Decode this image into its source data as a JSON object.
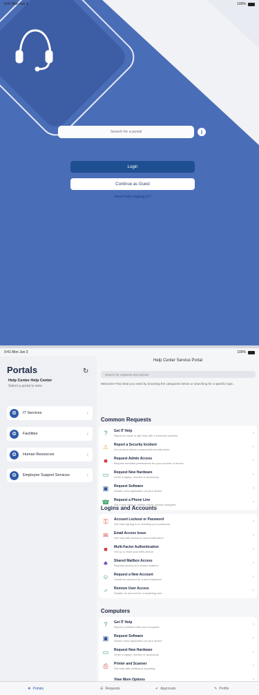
{
  "login_screen": {
    "status": {
      "time": "9:41 Mon Jun 3",
      "battery": "100%"
    },
    "search_placeholder": "Search for a portal",
    "info_symbol": "i",
    "login_label": "Login",
    "guest_label": "Continue as Guest",
    "help_link": "Need help logging in?",
    "colors": {
      "brand_blue": "#4a6db8",
      "button_blue": "#1e4f91"
    }
  },
  "portal_screen": {
    "status": {
      "time": "9:41 Mon Jun 3",
      "battery": "100%"
    },
    "sidebar": {
      "title": "Portals",
      "subtitle": "Help Center Help Center",
      "caption": "Select a portal to view",
      "items": [
        {
          "label": "IT Services"
        },
        {
          "label": "Facilities"
        },
        {
          "label": "Human Resources"
        },
        {
          "label": "Employee Support Services"
        }
      ]
    },
    "main": {
      "title": "Help Center Service Portal",
      "search_placeholder": "Search for requests and articles",
      "description": "Welcome! Find what you need by browsing the categories below or searching for a specific topic.",
      "sections": [
        {
          "heading": "Common Requests",
          "rows": [
            {
              "title": "Get IT Help",
              "subtitle": "Report an issue or get help with a technical problem",
              "icon": "help-icon"
            },
            {
              "title": "Report a Security Incident",
              "subtitle": "Let us know about a suspected security issue",
              "icon": "warning-icon"
            },
            {
              "title": "Request Admin Access",
              "subtitle": "Request elevated permissions for your account or device",
              "icon": "lock-icon"
            },
            {
              "title": "Request New Hardware",
              "subtitle": "Order a laptop, monitor or accessory",
              "icon": "laptop-icon"
            },
            {
              "title": "Request Software",
              "subtitle": "Install a new application on your device",
              "icon": "software-icon"
            },
            {
              "title": "Request a Phone Line",
              "subtitle": "Get a new desk or mobile phone number assigned",
              "icon": "phone-icon"
            }
          ]
        },
        {
          "heading": "Logins and Accounts",
          "rows": [
            {
              "title": "Account Lockout or Password",
              "subtitle": "Get help signing in or resetting your password",
              "icon": "key-icon"
            },
            {
              "title": "Email Access Issue",
              "subtitle": "Get help with access to your email inbox",
              "icon": "mail-icon"
            },
            {
              "title": "Multi-Factor Authentication",
              "subtitle": "Set up or reset your MFA device",
              "icon": "lock-icon"
            },
            {
              "title": "Shared Mailbox Access",
              "subtitle": "Request access to a shared mailbox",
              "icon": "group-icon"
            },
            {
              "title": "Request a New Account",
              "subtitle": "Create an account for a new employee",
              "icon": "account-icon"
            },
            {
              "title": "Remove User Access",
              "subtitle": "Disable an account for a departing user",
              "icon": "user-remove-icon"
            }
          ]
        },
        {
          "heading": "Computers",
          "rows": [
            {
              "title": "Get IT Help",
              "subtitle": "Report a problem with your computer",
              "icon": "help-icon"
            },
            {
              "title": "Request Software",
              "subtitle": "Install a new application on your device",
              "icon": "software-icon"
            },
            {
              "title": "Request New Hardware",
              "subtitle": "Order a laptop, monitor or accessory",
              "icon": "laptop-icon"
            },
            {
              "title": "Printer and Scanner",
              "subtitle": "Get help with printing or scanning",
              "icon": "printer-icon"
            },
            {
              "title": "View More Options",
              "subtitle": "",
              "icon": "more-icon"
            }
          ]
        }
      ]
    },
    "tabbar": [
      {
        "label": "Portals",
        "icon": "portals-icon",
        "active": true
      },
      {
        "label": "Requests",
        "icon": "requests-icon",
        "active": false
      },
      {
        "label": "Approvals",
        "icon": "approvals-icon",
        "active": false
      },
      {
        "label": "Profile",
        "icon": "profile-icon",
        "active": false
      }
    ]
  }
}
